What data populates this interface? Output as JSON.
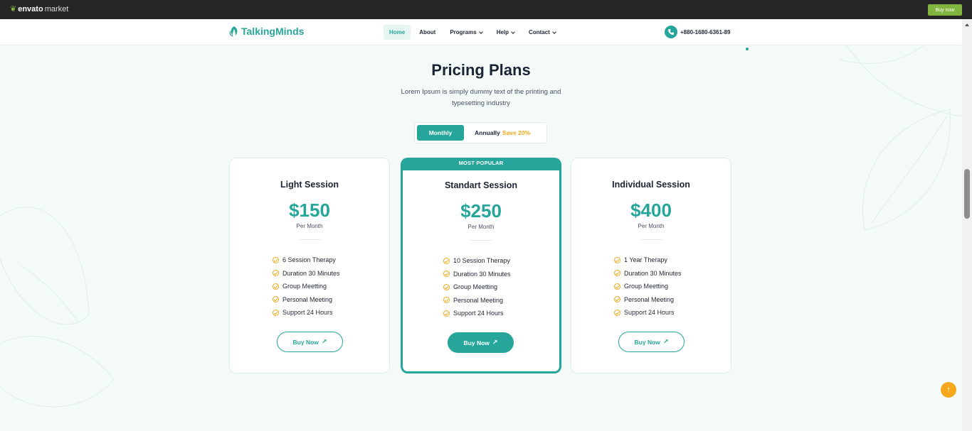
{
  "envato": {
    "logo_text": "envato",
    "logo_suffix": "market",
    "buy_label": "Buy now"
  },
  "nav": {
    "brand": "TalkingMinds",
    "items": [
      {
        "label": "Home",
        "active": true,
        "dropdown": false
      },
      {
        "label": "About",
        "active": false,
        "dropdown": false
      },
      {
        "label": "Programs",
        "active": false,
        "dropdown": true
      },
      {
        "label": "Help",
        "active": false,
        "dropdown": true
      },
      {
        "label": "Contact",
        "active": false,
        "dropdown": true
      }
    ],
    "phone": "+880-1680-6361-89"
  },
  "section": {
    "title": "Pricing Plans",
    "subtitle": "Lorem Ipsum is simply dummy text of the printing and typesetting industry"
  },
  "toggle": {
    "monthly": "Monthly",
    "annually": "Annually",
    "save": "Save 20%"
  },
  "plans": [
    {
      "name": "Light Session",
      "price": "$150",
      "period": "Per Month",
      "popular": false,
      "features": [
        "6 Session Therapy",
        "Duration 30 Minutes",
        "Group Meetting",
        "Personal Meeting",
        "Support 24 Hours"
      ],
      "cta": "Buy Now"
    },
    {
      "name": "Standart Session",
      "price": "$250",
      "period": "Per Month",
      "popular": true,
      "badge": "MOST POPULAR",
      "features": [
        "10 Session Therapy",
        "Duration 30 Minutes",
        "Group Meetting",
        "Personal Meeting",
        "Support 24 Hours"
      ],
      "cta": "Buy Now"
    },
    {
      "name": "Individual Session",
      "price": "$400",
      "period": "Per Month",
      "popular": false,
      "features": [
        "1 Year Therapy",
        "Duration 30 Minutes",
        "Group Meetting",
        "Personal Meeting",
        "Support 24 Hours"
      ],
      "cta": "Buy Now"
    }
  ],
  "colors": {
    "accent": "#26a69a",
    "highlight": "#f0a818",
    "background": "#f3faf8",
    "envato_green": "#82b540"
  },
  "icons": {
    "brand": "leaf-icon",
    "phone": "phone-icon",
    "check": "check-circle-icon",
    "arrow": "arrow-up-right-icon",
    "scroll_top": "arrow-up-icon"
  }
}
